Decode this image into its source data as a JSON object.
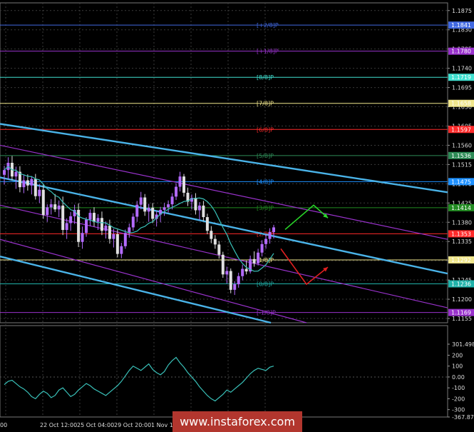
{
  "chart_data": [
    {
      "type": "candlestick",
      "price_axis": {
        "ticks": [
          "1.1875",
          "1.1830",
          "1.1785",
          "1.1740",
          "1.1695",
          "1.1650",
          "1.1605",
          "1.1560",
          "1.1515",
          "1.1470",
          "1.1425",
          "1.1380",
          "1.1335",
          "1.1290",
          "1.1245",
          "1.1200",
          "1.1155"
        ],
        "ylim": [
          1.1145,
          1.1893
        ]
      },
      "time_axis": {
        "ticks": [
          "00",
          "22 Oct 12:00",
          "25 Oct 04:00",
          "29 Oct 20:00",
          "1 Nov 12:00",
          "6 Nov 04:00",
          "8 Nov 20:00",
          "13 Nov 12:00"
        ]
      },
      "murray_levels": [
        {
          "label": "[+2/8]P",
          "price": 1.1841,
          "color": "#4169e1"
        },
        {
          "label": "[+1/8]P",
          "price": 1.178,
          "color": "#9932cc"
        },
        {
          "label": "[8/8]P",
          "price": 1.1719,
          "color": "#40e0d0"
        },
        {
          "label": "[7/8]P",
          "price": 1.1658,
          "color": "#f0e68c"
        },
        {
          "label": "[6/8]P",
          "price": 1.1597,
          "color": "#ff2a2a"
        },
        {
          "label": "[5/8]P",
          "price": 1.1536,
          "color": "#2e8b57"
        },
        {
          "label": "[4/8]P",
          "price": 1.1475,
          "color": "#1e90ff"
        },
        {
          "label": "[3/8]P",
          "price": 1.1414,
          "color": "#228b22"
        },
        {
          "label": "[2/8]P",
          "price": 1.1353,
          "color": "#ff2a2a"
        },
        {
          "label": "[1/8]P",
          "price": 1.1292,
          "color": "#f0e68c"
        },
        {
          "label": "[0/8]P",
          "price": 1.1236,
          "color": "#20b2aa"
        },
        {
          "label": "[-1/8]P",
          "price": 1.1169,
          "color": "#9932cc"
        }
      ],
      "highlighted_prices": [
        "1.1292",
        "1.1236",
        "1.1169"
      ],
      "candles": [
        [
          1.1491,
          1.1512,
          1.1468,
          1.1502
        ],
        [
          1.1502,
          1.1532,
          1.148,
          1.1519
        ],
        [
          1.1519,
          1.1535,
          1.1478,
          1.1487
        ],
        [
          1.1487,
          1.151,
          1.1458,
          1.1498
        ],
        [
          1.1498,
          1.1511,
          1.145,
          1.1462
        ],
        [
          1.1462,
          1.149,
          1.1448,
          1.1478
        ],
        [
          1.1478,
          1.1492,
          1.1454,
          1.1466
        ],
        [
          1.1466,
          1.1488,
          1.1445,
          1.1481
        ],
        [
          1.1481,
          1.1493,
          1.1433,
          1.1441
        ],
        [
          1.1441,
          1.1469,
          1.1425,
          1.1456
        ],
        [
          1.1456,
          1.147,
          1.1388,
          1.1397
        ],
        [
          1.1397,
          1.1422,
          1.1381,
          1.1415
        ],
        [
          1.1415,
          1.1434,
          1.1398,
          1.1422
        ],
        [
          1.1422,
          1.1446,
          1.1404,
          1.141
        ],
        [
          1.141,
          1.1431,
          1.1392,
          1.1419
        ],
        [
          1.1419,
          1.144,
          1.135,
          1.1362
        ],
        [
          1.1362,
          1.1389,
          1.1341,
          1.1378
        ],
        [
          1.1378,
          1.1404,
          1.136,
          1.1394
        ],
        [
          1.1394,
          1.1421,
          1.1376,
          1.1409
        ],
        [
          1.1409,
          1.1424,
          1.1322,
          1.1334
        ],
        [
          1.1334,
          1.137,
          1.1318,
          1.1355
        ],
        [
          1.1355,
          1.1392,
          1.1346,
          1.1386
        ],
        [
          1.1386,
          1.141,
          1.1371,
          1.1402
        ],
        [
          1.1402,
          1.1415,
          1.137,
          1.1381
        ],
        [
          1.1381,
          1.1399,
          1.1362,
          1.139
        ],
        [
          1.139,
          1.1405,
          1.135,
          1.136
        ],
        [
          1.136,
          1.1382,
          1.1342,
          1.1372
        ],
        [
          1.1372,
          1.1386,
          1.133,
          1.1341
        ],
        [
          1.1341,
          1.1365,
          1.1321,
          1.1352
        ],
        [
          1.1352,
          1.1363,
          1.1298,
          1.1306
        ],
        [
          1.1306,
          1.1332,
          1.1296,
          1.1324
        ],
        [
          1.1324,
          1.1363,
          1.1318,
          1.1355
        ],
        [
          1.1355,
          1.1377,
          1.1344,
          1.1368
        ],
        [
          1.1368,
          1.1401,
          1.136,
          1.1393
        ],
        [
          1.1393,
          1.143,
          1.1381,
          1.1421
        ],
        [
          1.1421,
          1.1451,
          1.141,
          1.1438
        ],
        [
          1.1438,
          1.1446,
          1.1395,
          1.1405
        ],
        [
          1.1405,
          1.1423,
          1.1381,
          1.1414
        ],
        [
          1.1414,
          1.1425,
          1.1378,
          1.1388
        ],
        [
          1.1388,
          1.1407,
          1.137,
          1.1398
        ],
        [
          1.1398,
          1.1416,
          1.138,
          1.1409
        ],
        [
          1.1409,
          1.1425,
          1.1395,
          1.1415
        ],
        [
          1.1415,
          1.1431,
          1.1403,
          1.1422
        ],
        [
          1.1422,
          1.1448,
          1.141,
          1.144
        ],
        [
          1.144,
          1.1471,
          1.1432,
          1.1463
        ],
        [
          1.1463,
          1.1498,
          1.1452,
          1.1487
        ],
        [
          1.1487,
          1.1493,
          1.144,
          1.1449
        ],
        [
          1.1449,
          1.1461,
          1.1418,
          1.1428
        ],
        [
          1.1428,
          1.1445,
          1.141,
          1.1437
        ],
        [
          1.1437,
          1.1448,
          1.1398,
          1.1408
        ],
        [
          1.1408,
          1.1427,
          1.1385,
          1.1419
        ],
        [
          1.1419,
          1.143,
          1.1383,
          1.1392
        ],
        [
          1.1392,
          1.14,
          1.1352,
          1.136
        ],
        [
          1.136,
          1.1371,
          1.1331,
          1.1341
        ],
        [
          1.1341,
          1.135,
          1.1318,
          1.1328
        ],
        [
          1.1328,
          1.1336,
          1.1295,
          1.1304
        ],
        [
          1.1304,
          1.1311,
          1.125,
          1.1258
        ],
        [
          1.1258,
          1.1276,
          1.1237,
          1.1266
        ],
        [
          1.1266,
          1.1272,
          1.1214,
          1.1222
        ],
        [
          1.1222,
          1.1242,
          1.121,
          1.1235
        ],
        [
          1.1235,
          1.1262,
          1.1227,
          1.1254
        ],
        [
          1.1254,
          1.1281,
          1.1244,
          1.1271
        ],
        [
          1.1271,
          1.129,
          1.1258,
          1.1265
        ],
        [
          1.1265,
          1.1302,
          1.126,
          1.1294
        ],
        [
          1.1294,
          1.1312,
          1.1276,
          1.1284
        ],
        [
          1.1284,
          1.1318,
          1.1279,
          1.1309
        ],
        [
          1.1309,
          1.1338,
          1.13,
          1.1329
        ],
        [
          1.1329,
          1.1352,
          1.1318,
          1.1341
        ],
        [
          1.1341,
          1.1366,
          1.133,
          1.1357
        ],
        [
          1.1357,
          1.1374,
          1.1342,
          1.1368
        ]
      ],
      "indicator": {
        "axis_ticks": [
          "301.498",
          "200",
          "100",
          "0.00",
          "-100",
          "-200",
          "-300",
          "-367.870"
        ],
        "ylim": [
          -367.87,
          301.498
        ],
        "values": [
          -70,
          -40,
          -30,
          -60,
          -90,
          -110,
          -140,
          -180,
          -200,
          -160,
          -130,
          -150,
          -190,
          -170,
          -120,
          -100,
          -140,
          -180,
          -160,
          -120,
          -90,
          -60,
          -80,
          -110,
          -130,
          -150,
          -170,
          -140,
          -110,
          -80,
          -40,
          10,
          60,
          100,
          80,
          60,
          90,
          120,
          70,
          40,
          20,
          50,
          110,
          150,
          180,
          130,
          90,
          40,
          0,
          -40,
          -90,
          -130,
          -170,
          -200,
          -220,
          -190,
          -160,
          -120,
          -140,
          -110,
          -80,
          -50,
          -10,
          30,
          60,
          80,
          70,
          60,
          90,
          100
        ]
      }
    }
  ],
  "watermark": "www.instaforex.com"
}
